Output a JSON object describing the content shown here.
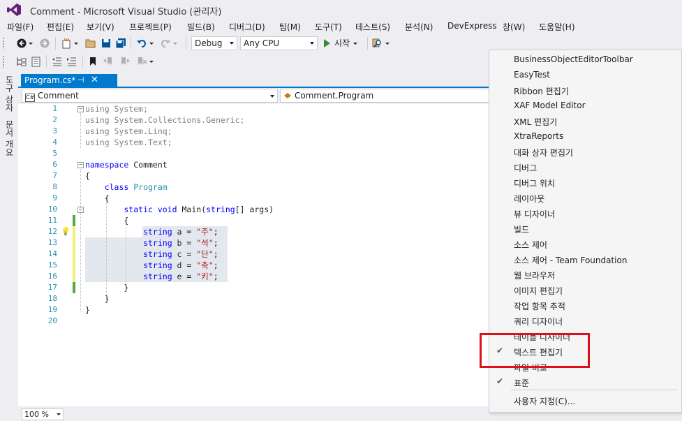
{
  "window": {
    "title": "Comment - Microsoft Visual Studio  (관리자)"
  },
  "menu": [
    "파일(F)",
    "편집(E)",
    "보기(V)",
    "프로젝트(P)",
    "빌드(B)",
    "디버그(D)",
    "팀(M)",
    "도구(T)",
    "테스트(S)",
    "분석(N)",
    "DevExpress",
    "창(W)",
    "도움말(H)"
  ],
  "toolbar": {
    "config": "Debug",
    "platform": "Any CPU",
    "start_label": "시작"
  },
  "left_strip": {
    "toolbox": "도구 상자",
    "doc_outline": "문서 개요"
  },
  "doc_tab": {
    "label": "Program.cs*",
    "pin": "⊣",
    "close": "✕"
  },
  "nav": {
    "project": "Comment",
    "class": "Comment.Program"
  },
  "editor": {
    "line_numbers": [
      "1",
      "2",
      "3",
      "4",
      "5",
      "6",
      "7",
      "8",
      "9",
      "10",
      "11",
      "12",
      "13",
      "14",
      "15",
      "16",
      "17",
      "18",
      "19",
      "20"
    ],
    "lines": [
      [
        {
          "t": "using",
          "c": "gy"
        },
        {
          "t": " System;",
          "c": "gy"
        }
      ],
      [
        {
          "t": "using",
          "c": "gy"
        },
        {
          "t": " System.Collections.Generic;",
          "c": "gy"
        }
      ],
      [
        {
          "t": "using",
          "c": "gy"
        },
        {
          "t": " System.Linq;",
          "c": "gy"
        }
      ],
      [
        {
          "t": "using",
          "c": "gy"
        },
        {
          "t": " System.Text;",
          "c": "gy"
        }
      ],
      [],
      [
        {
          "t": "namespace",
          "c": "kw"
        },
        {
          "t": " Comment",
          "c": ""
        }
      ],
      [
        {
          "t": "{",
          "c": ""
        }
      ],
      [
        {
          "t": "    class",
          "c": "kw"
        },
        {
          "t": " Program",
          "c": "ty"
        }
      ],
      [
        {
          "t": "    {",
          "c": ""
        }
      ],
      [
        {
          "t": "        static",
          "c": "kw"
        },
        {
          "t": " ",
          "c": ""
        },
        {
          "t": "void",
          "c": "kw"
        },
        {
          "t": " Main(",
          "c": ""
        },
        {
          "t": "string",
          "c": "kw"
        },
        {
          "t": "[] args)",
          "c": ""
        }
      ],
      [
        {
          "t": "        {",
          "c": ""
        }
      ],
      [
        {
          "t": "            string",
          "c": "kw"
        },
        {
          "t": " a = ",
          "c": ""
        },
        {
          "t": "\"주\"",
          "c": "st"
        },
        {
          "t": ";",
          "c": ""
        }
      ],
      [
        {
          "t": "            string",
          "c": "kw"
        },
        {
          "t": " b = ",
          "c": ""
        },
        {
          "t": "\"석\"",
          "c": "st"
        },
        {
          "t": ";",
          "c": ""
        }
      ],
      [
        {
          "t": "            string",
          "c": "kw"
        },
        {
          "t": " c = ",
          "c": ""
        },
        {
          "t": "\"단\"",
          "c": "st"
        },
        {
          "t": ";",
          "c": ""
        }
      ],
      [
        {
          "t": "            string",
          "c": "kw"
        },
        {
          "t": " d = ",
          "c": ""
        },
        {
          "t": "\"축\"",
          "c": "st"
        },
        {
          "t": ";",
          "c": ""
        }
      ],
      [
        {
          "t": "            string",
          "c": "kw"
        },
        {
          "t": " e = ",
          "c": ""
        },
        {
          "t": "\"키\"",
          "c": "st"
        },
        {
          "t": ";",
          "c": ""
        }
      ],
      [
        {
          "t": "        }",
          "c": ""
        }
      ],
      [
        {
          "t": "    }",
          "c": ""
        }
      ],
      [
        {
          "t": "}",
          "c": ""
        }
      ],
      []
    ]
  },
  "zoom": "100 %",
  "context_menu": {
    "items": [
      {
        "label": "BusinessObjectEditorToolbar",
        "checked": false
      },
      {
        "label": "EasyTest",
        "checked": false
      },
      {
        "label": "Ribbon 편집기",
        "checked": false
      },
      {
        "label": "XAF Model Editor",
        "checked": false
      },
      {
        "label": "XML 편집기",
        "checked": false
      },
      {
        "label": "XtraReports",
        "checked": false
      },
      {
        "label": "대화 상자 편집기",
        "checked": false
      },
      {
        "label": "디버그",
        "checked": false
      },
      {
        "label": "디버그 위치",
        "checked": false
      },
      {
        "label": "레이아웃",
        "checked": false
      },
      {
        "label": "뷰 디자이너",
        "checked": false
      },
      {
        "label": "빌드",
        "checked": false
      },
      {
        "label": "소스 제어",
        "checked": false
      },
      {
        "label": "소스 제어 - Team Foundation",
        "checked": false
      },
      {
        "label": "웹 브라우저",
        "checked": false
      },
      {
        "label": "이미지 편집기",
        "checked": false
      },
      {
        "label": "작업 항목 추적",
        "checked": false
      },
      {
        "label": "쿼리 디자이너",
        "checked": false
      },
      {
        "label": "테이블 디자이너",
        "checked": false
      },
      {
        "label": "텍스트 편집기",
        "checked": true
      },
      {
        "label": "파일 비교",
        "checked": false
      },
      {
        "label": "표준",
        "checked": true
      }
    ],
    "customize": "사용자 지정(C)...",
    "check_glyph": "✔"
  },
  "colors": {
    "accent": "#007acc",
    "highlight_box": "#e0101a"
  }
}
